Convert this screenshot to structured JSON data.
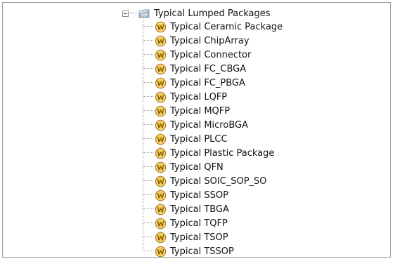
{
  "tree": {
    "root": {
      "label": "Typical Lumped Packages",
      "expanded": true,
      "icon": "folder-icon"
    },
    "children": [
      {
        "label": "Typical Ceramic Package",
        "icon": "w-badge-icon"
      },
      {
        "label": "Typical ChipArray",
        "icon": "w-badge-icon"
      },
      {
        "label": "Typical Connector",
        "icon": "w-badge-icon"
      },
      {
        "label": "Typical FC_CBGA",
        "icon": "w-badge-icon"
      },
      {
        "label": "Typical FC_PBGA",
        "icon": "w-badge-icon"
      },
      {
        "label": "Typical LQFP",
        "icon": "w-badge-icon"
      },
      {
        "label": "Typical MQFP",
        "icon": "w-badge-icon"
      },
      {
        "label": "Typical MicroBGA",
        "icon": "w-badge-icon"
      },
      {
        "label": "Typical PLCC",
        "icon": "w-badge-icon"
      },
      {
        "label": "Typical Plastic Package",
        "icon": "w-badge-icon"
      },
      {
        "label": "Typical QFN",
        "icon": "w-badge-icon"
      },
      {
        "label": "Typical SOIC_SOP_SO",
        "icon": "w-badge-icon"
      },
      {
        "label": "Typical SSOP",
        "icon": "w-badge-icon"
      },
      {
        "label": "Typical TBGA",
        "icon": "w-badge-icon"
      },
      {
        "label": "Typical TQFP",
        "icon": "w-badge-icon"
      },
      {
        "label": "Typical TSOP",
        "icon": "w-badge-icon"
      },
      {
        "label": "Typical TSSOP",
        "icon": "w-badge-icon"
      }
    ]
  },
  "colors": {
    "border": "#9a9a9a",
    "text": "#111111",
    "w_icon_fill": "#f2c44b",
    "w_icon_stroke": "#a47a12",
    "folder_fill": "#dfe7f2",
    "folder_stroke": "#7f8ea6"
  }
}
